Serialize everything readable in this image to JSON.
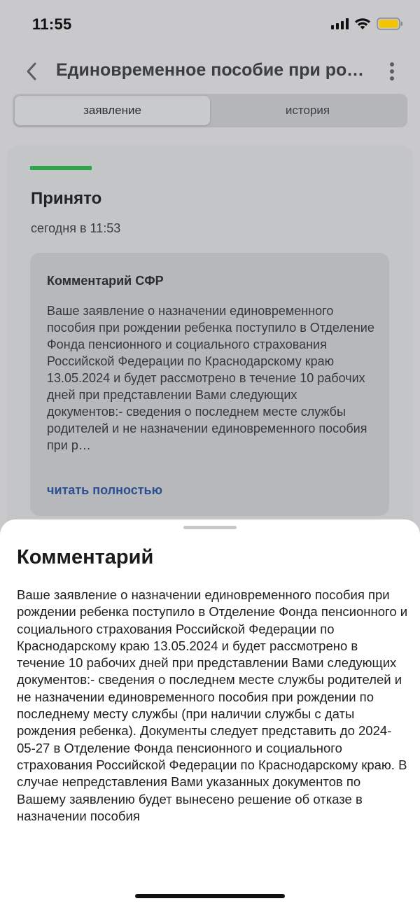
{
  "status_bar": {
    "time": "11:55",
    "icons": [
      "signal-icon",
      "wifi-icon",
      "battery-icon"
    ],
    "battery_color": "#f5c400"
  },
  "header": {
    "back_icon": "chevron-left-icon",
    "title": "Единовременное пособие при рождении ребенка",
    "more_icon": "more-vertical-icon"
  },
  "tabs": [
    {
      "label": "заявление",
      "active": true
    },
    {
      "label": "история",
      "active": false
    }
  ],
  "status_card": {
    "stripe_color": "#2fa34a",
    "title": "Принято",
    "date": "сегодня в 11:53",
    "comment": {
      "title": "Комментарий СФР",
      "text": "Ваше заявление о назначении единовременного пособия при рождении ребенка поступило в Отделение Фонда пенсионного и социального страхования Российской Федерации по Краснодарскому краю 13.05.2024 и будет рассмотрено в течение 10 рабочих дней при представлении Вами следующих документов:- сведения о последнем месте службы родителей и не назначении единовременного пособия при р…",
      "read_more": "читать полностью"
    }
  },
  "sheet": {
    "title": "Комментарий",
    "text": "Ваше заявление о назначении единовременного пособия при рождении ребенка поступило в Отделение Фонда пенсионного и социального страхования Российской Федерации по Краснодарскому краю 13.05.2024 и будет рассмотрено в течение 10 рабочих дней при представлении Вами следующих документов:- сведения о последнем месте службы родителей и не назначении единовременного пособия при рождении по последнему месту службы (при наличии службы с даты рождения ребенка). Документы следует представить до 2024-05-27 в Отделение Фонда пенсионного и социального страхования Российской Федерации по Краснодарскому краю. В случае непредставления Вами указанных документов по Вашему заявлению будет вынесено решение об отказе в назначении пособия"
  }
}
